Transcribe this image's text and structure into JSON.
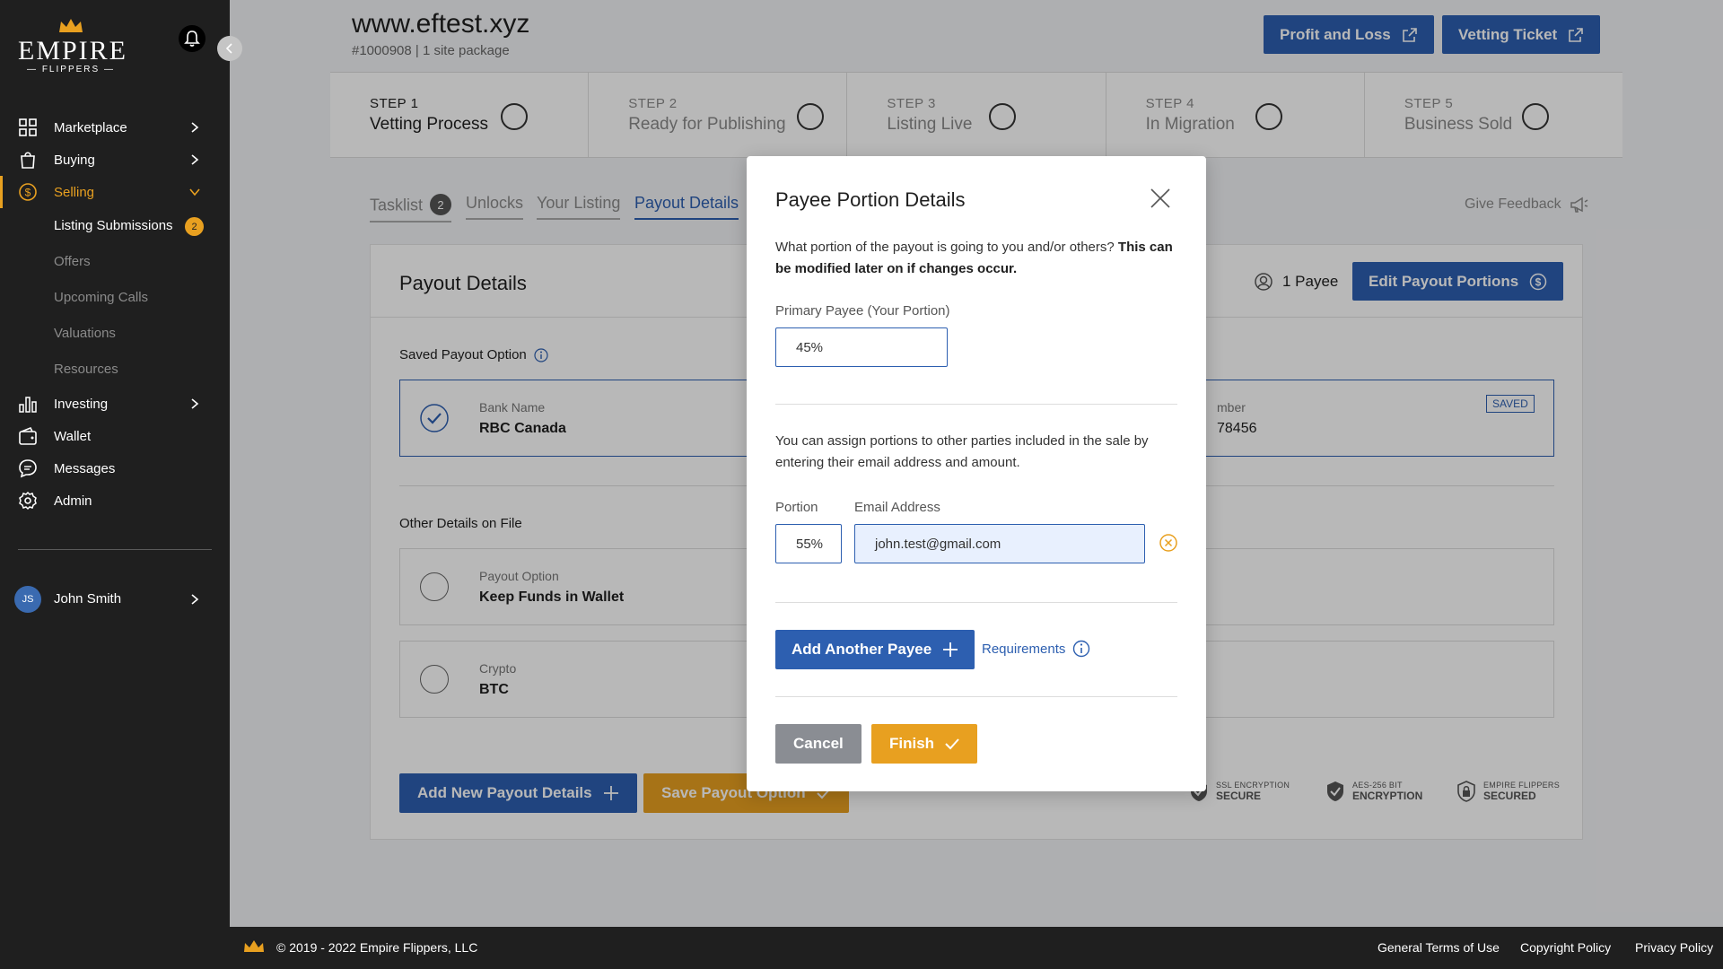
{
  "sidebar": {
    "logo_main": "EMPIRE",
    "logo_sub": "— FLIPPERS —",
    "items": {
      "marketplace": "Marketplace",
      "buying": "Buying",
      "selling": "Selling",
      "investing": "Investing",
      "wallet": "Wallet",
      "messages": "Messages",
      "admin": "Admin"
    },
    "selling_sub": {
      "listing_submissions": "Listing Submissions",
      "listing_submissions_badge": "2",
      "offers": "Offers",
      "upcoming_calls": "Upcoming Calls",
      "valuations": "Valuations",
      "resources": "Resources"
    },
    "user": {
      "initials": "JS",
      "name": "John Smith"
    }
  },
  "header": {
    "title": "www.eftest.xyz",
    "subtitle": "#1000908 | 1 site package",
    "profit_loss": "Profit and Loss",
    "vetting_ticket": "Vetting Ticket"
  },
  "steps": [
    {
      "num": "STEP 1",
      "title": "Vetting Process"
    },
    {
      "num": "STEP 2",
      "title": "Ready for Publishing"
    },
    {
      "num": "STEP 3",
      "title": "Listing Live"
    },
    {
      "num": "STEP 4",
      "title": "In Migration"
    },
    {
      "num": "STEP 5",
      "title": "Business Sold"
    }
  ],
  "tabs": {
    "tasklist": "Tasklist",
    "tasklist_badge": "2",
    "unlocks": "Unlocks",
    "your_listing": "Your Listing",
    "payout_details": "Payout Details",
    "give_feedback": "Give Feedback"
  },
  "card": {
    "title": "Payout Details",
    "payee_count": "1 Payee",
    "edit_portions": "Edit Payout Portions",
    "saved_option_label": "Saved Payout Option",
    "saved": {
      "bank_key": "Bank Name",
      "bank_val": "RBC Canada",
      "num_key": "mber",
      "num_val": "78456",
      "badge": "SAVED"
    },
    "other_label": "Other Details on File",
    "other": [
      {
        "key": "Payout Option",
        "val": "Keep Funds in Wallet"
      },
      {
        "key": "Crypto",
        "val": "BTC"
      }
    ],
    "add_new": "Add New Payout Details",
    "save_option": "Save Payout Option",
    "security": [
      {
        "a": "SSL ENCRYPTION",
        "b": "SECURE"
      },
      {
        "a": "AES-256 BIT",
        "b": "ENCRYPTION"
      },
      {
        "a": "EMPIRE FLIPPERS",
        "b": "SECURED"
      }
    ]
  },
  "modal": {
    "title": "Payee Portion Details",
    "intro": "What portion of the payout is going to you and/or others?",
    "intro_bold": "This can be modified later on if changes occur.",
    "primary_label": "Primary Payee (Your Portion)",
    "primary_value": "45%",
    "assign_text": "You can assign portions to other parties included in the sale by entering their email address and amount.",
    "portion_label": "Portion",
    "email_label": "Email Address",
    "portion_value": "55%",
    "email_value": "john.test@gmail.com",
    "add_payee": "Add Another Payee",
    "requirements": "Requirements",
    "cancel": "Cancel",
    "finish": "Finish"
  },
  "footer": {
    "copyright": "© 2019 - 2022 Empire Flippers, LLC",
    "terms": "General Terms of Use",
    "copyright_policy": "Copyright Policy",
    "privacy": "Privacy Policy"
  },
  "colors": {
    "accent": "#2d5fb0",
    "brand": "#e8a020",
    "sidebar": "#1f1f1f"
  }
}
